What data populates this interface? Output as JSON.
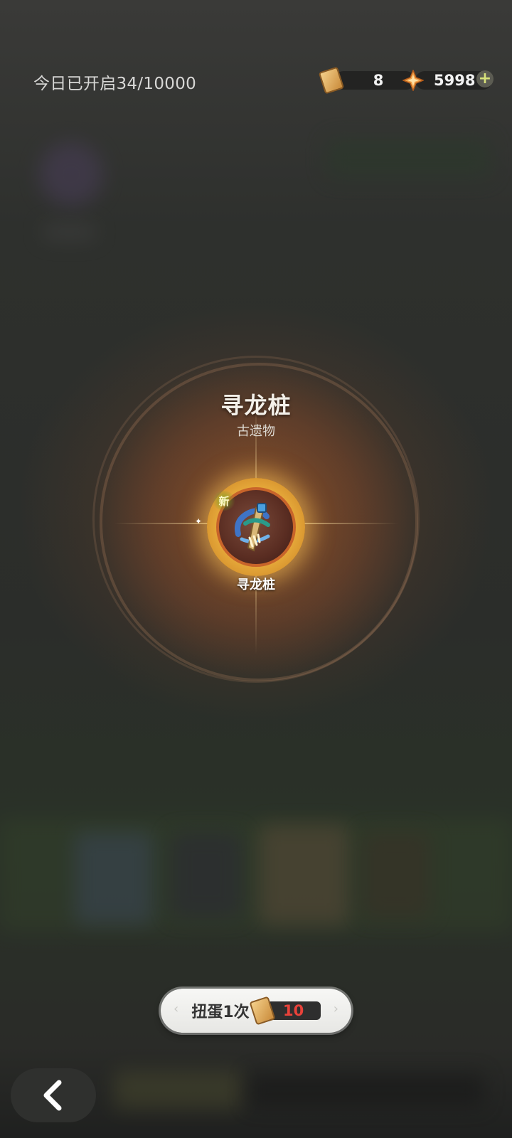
{
  "header": {
    "daily_opened": "今日已开启34/10000",
    "tickets_count": "8",
    "gems_count": "5998",
    "ticket_icon": "gacha-ticket-icon",
    "gem_icon": "star-gem-icon",
    "add_icon": "plus-icon"
  },
  "reward": {
    "title": "寻龙桩",
    "category": "古遗物",
    "item_name": "寻龙桩",
    "new_tag": "新",
    "item_icon": "relic-icon"
  },
  "draw": {
    "label": "扭蛋1次",
    "cost": "10",
    "cost_icon": "gacha-ticket-icon"
  },
  "footer": {
    "back_icon": "chevron-left-icon"
  },
  "colors": {
    "accent_gold": "#e6a93a",
    "cost_red": "#e8423a",
    "plus_yellow": "#d8e27a"
  }
}
